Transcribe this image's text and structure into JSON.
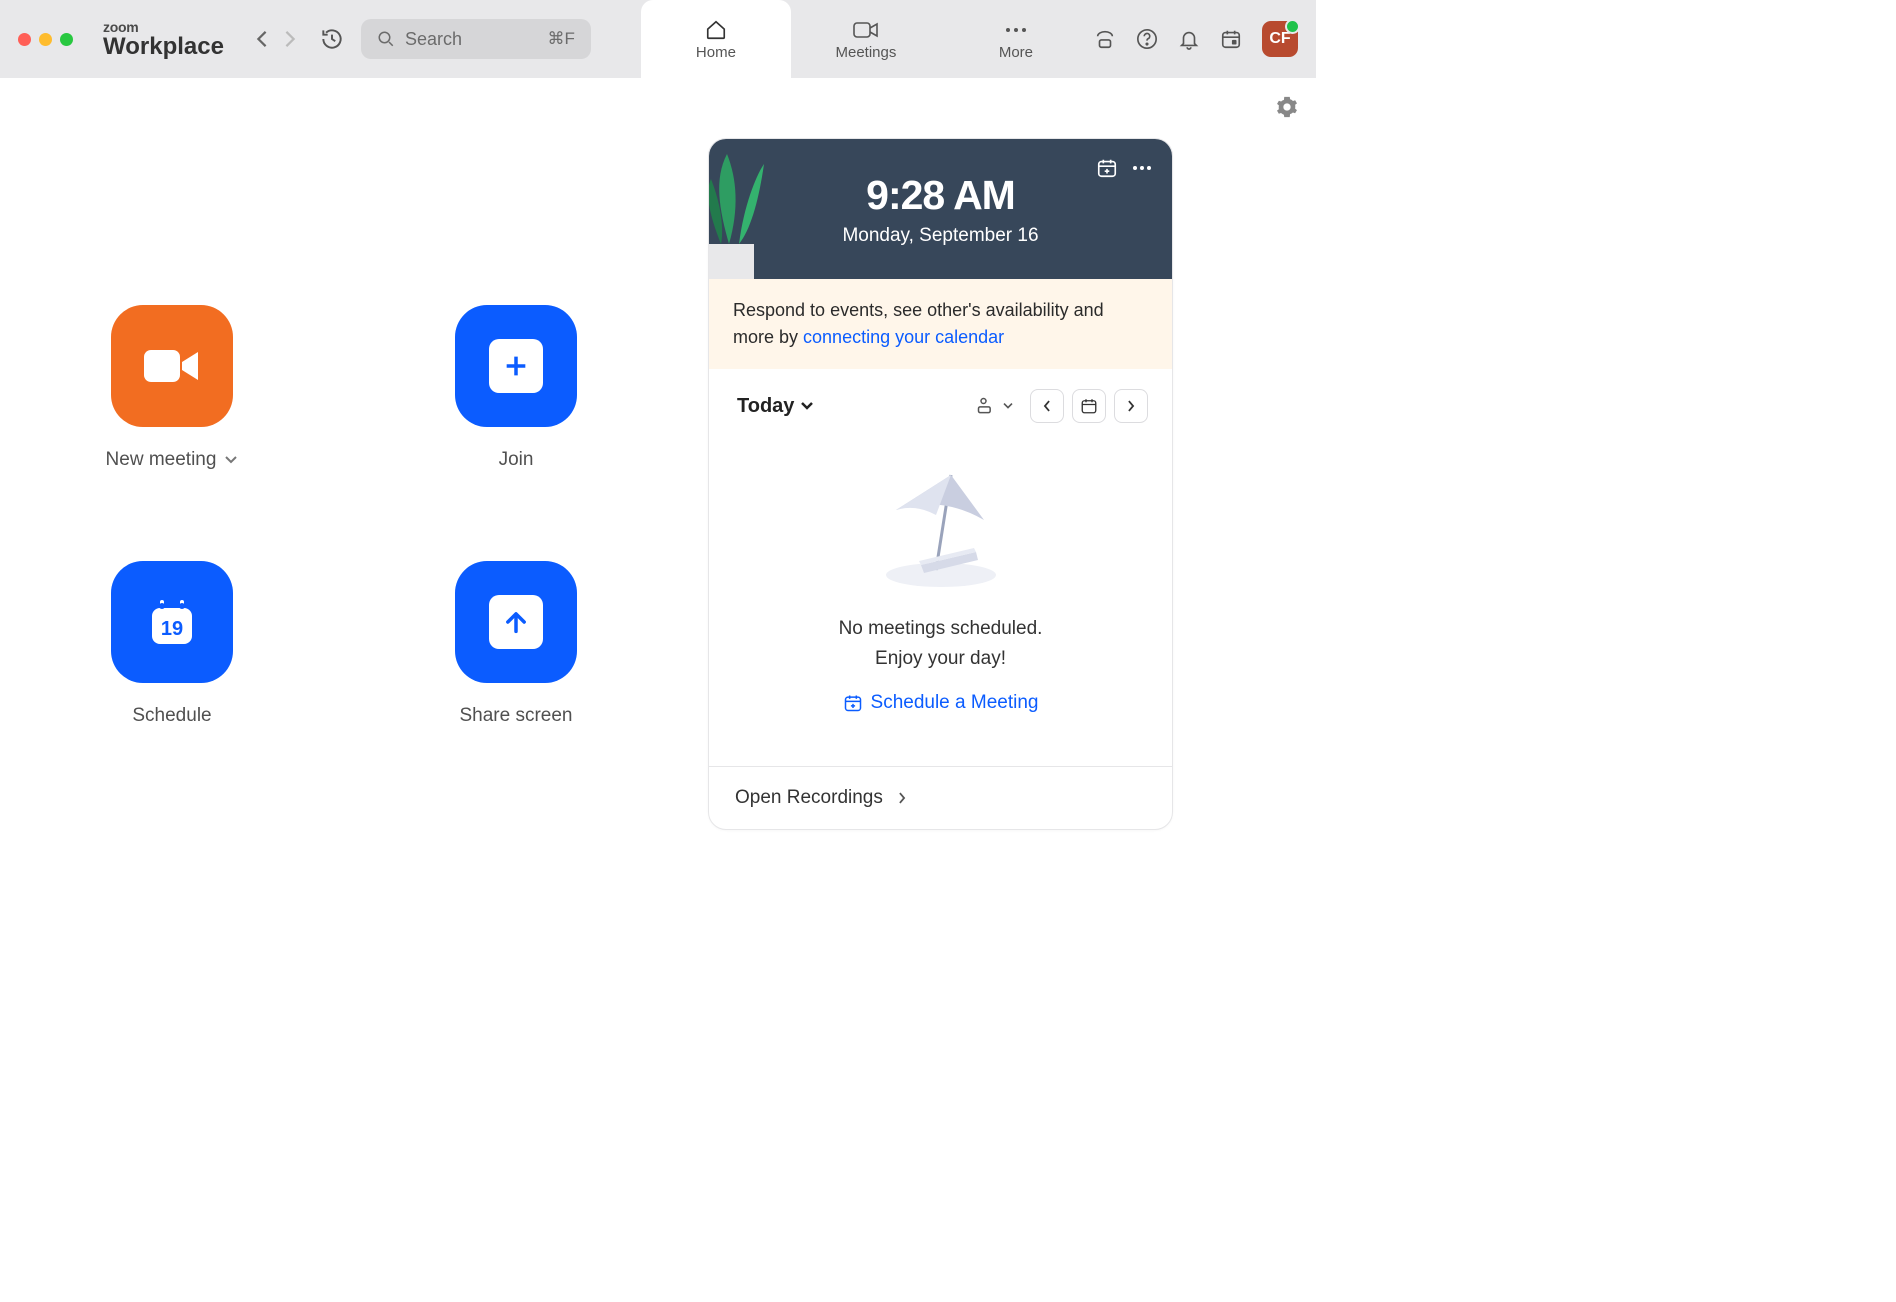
{
  "app": {
    "brand": "zoom",
    "product": "Workplace"
  },
  "search": {
    "placeholder": "Search",
    "shortcut": "⌘F"
  },
  "tabs": {
    "home": "Home",
    "meetings": "Meetings",
    "more": "More"
  },
  "avatar": {
    "initials": "CF"
  },
  "actions": {
    "new_meeting": "New meeting",
    "join": "Join",
    "schedule": "Schedule",
    "schedule_day": "19",
    "share_screen": "Share screen"
  },
  "calendar": {
    "time": "9:28 AM",
    "date": "Monday, September 16",
    "banner_pre": "Respond to events, see other's availability and more by ",
    "banner_link": "connecting your calendar",
    "today": "Today",
    "empty1": "No meetings scheduled.",
    "empty2": "Enjoy your day!",
    "schedule_meeting": "Schedule a Meeting",
    "open_recordings": "Open Recordings"
  }
}
